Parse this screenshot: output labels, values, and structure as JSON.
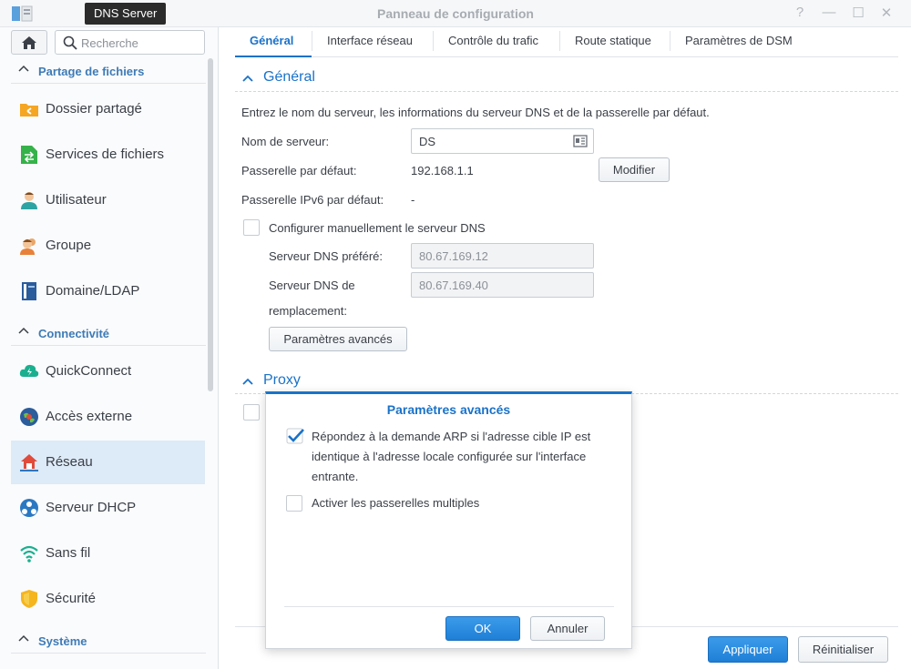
{
  "window": {
    "title": "Panneau de configuration",
    "tooltip": "DNS Server"
  },
  "sidebar": {
    "search_placeholder": "Recherche",
    "sections": [
      {
        "label": "Partage de fichiers"
      },
      {
        "label": "Connectivité"
      },
      {
        "label": "Système"
      }
    ],
    "items": [
      {
        "label": "Dossier partagé",
        "icon": "shared-folder-icon"
      },
      {
        "label": "Services de fichiers",
        "icon": "file-services-icon"
      },
      {
        "label": "Utilisateur",
        "icon": "user-icon"
      },
      {
        "label": "Groupe",
        "icon": "group-icon"
      },
      {
        "label": "Domaine/LDAP",
        "icon": "domain-ldap-icon"
      },
      {
        "label": "QuickConnect",
        "icon": "quickconnect-icon"
      },
      {
        "label": "Accès externe",
        "icon": "external-access-icon"
      },
      {
        "label": "Réseau",
        "icon": "network-icon",
        "active": true
      },
      {
        "label": "Serveur DHCP",
        "icon": "dhcp-server-icon"
      },
      {
        "label": "Sans fil",
        "icon": "wireless-icon"
      },
      {
        "label": "Sécurité",
        "icon": "security-icon"
      }
    ]
  },
  "tabs": [
    {
      "label": "Général",
      "active": true
    },
    {
      "label": "Interface réseau"
    },
    {
      "label": "Contrôle du trafic"
    },
    {
      "label": "Route statique"
    },
    {
      "label": "Paramètres de DSM"
    }
  ],
  "general": {
    "title": "Général",
    "description": "Entrez le nom du serveur, les informations du serveur DNS et de la passerelle par défaut.",
    "server_name_label": "Nom de serveur:",
    "server_name_value": "DS",
    "gateway_label": "Passerelle par défaut:",
    "gateway_value": "192.168.1.1",
    "modify_button": "Modifier",
    "ipv6_gateway_label": "Passerelle IPv6 par défaut:",
    "ipv6_gateway_value": "-",
    "manual_dns_label": "Configurer manuellement le serveur DNS",
    "preferred_dns_label": "Serveur DNS préféré:",
    "preferred_dns_value": "80.67.169.12",
    "alternate_dns_label_1": "Serveur DNS de",
    "alternate_dns_label_2": "remplacement:",
    "alternate_dns_value": "80.67.169.40",
    "advanced_button": "Paramètres avancés"
  },
  "proxy": {
    "title": "Proxy"
  },
  "dialog": {
    "title": "Paramètres avancés",
    "option1_line1": "Répondez à la demande ARP si l'adresse cible IP est",
    "option1_line2": "identique à l'adresse locale configurée sur l'interface",
    "option1_line3": "entrante.",
    "option1_checked": true,
    "option2": "Activer les passerelles multiples",
    "option2_checked": false,
    "ok_button": "OK",
    "cancel_button": "Annuler"
  },
  "footer": {
    "apply_button": "Appliquer",
    "reset_button": "Réinitialiser"
  },
  "colors": {
    "accent": "#1a72c9",
    "section_heading": "#3e7bb6",
    "active_item_bg": "#ddeaf7"
  }
}
